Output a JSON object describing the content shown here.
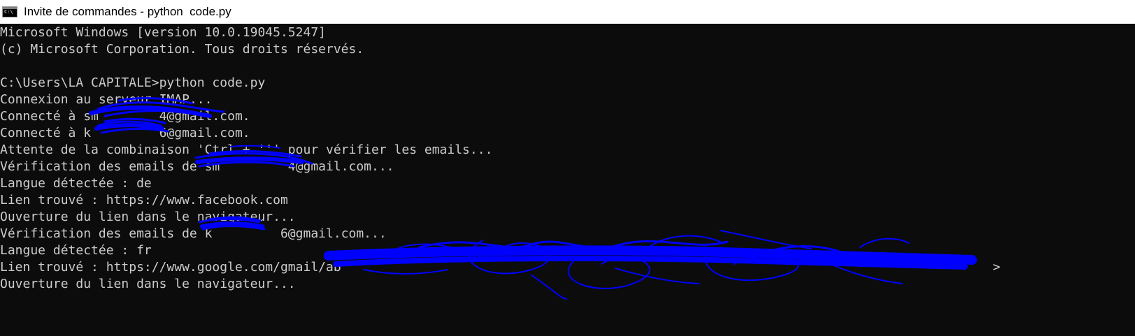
{
  "window": {
    "title": "Invite de commandes - python  code.py",
    "icon_label": "C:\\"
  },
  "console": {
    "lines": [
      "Microsoft Windows [version 10.0.19045.5247]",
      "(c) Microsoft Corporation. Tous droits réservés.",
      "",
      "C:\\Users\\LA CAPITALE>python code.py",
      "Connexion au serveur IMAP...",
      "Connecté à sm        4@gmail.com.",
      "Connecté à k         6@gmail.com.",
      "Attente de la combinaison 'Ctrl + ''' pour vérifier les emails...",
      "Vérification des emails de sm         4@gmail.com...",
      "Langue détectée : de",
      "Lien trouvé : https://www.facebook.com",
      "Ouverture du lien dans le navigateur...",
      "Vérification des emails de k         6@gmail.com...",
      "Langue détectée : fr",
      "Lien trouvé : https://www.google.com/gmail/ab                                                                                      >",
      "Ouverture du lien dans le navigateur..."
    ]
  },
  "colors": {
    "console_background": "#0c0c0c",
    "console_text": "#cccccc",
    "titlebar_background": "#ffffff",
    "redaction_scribble": "#0000ff"
  }
}
